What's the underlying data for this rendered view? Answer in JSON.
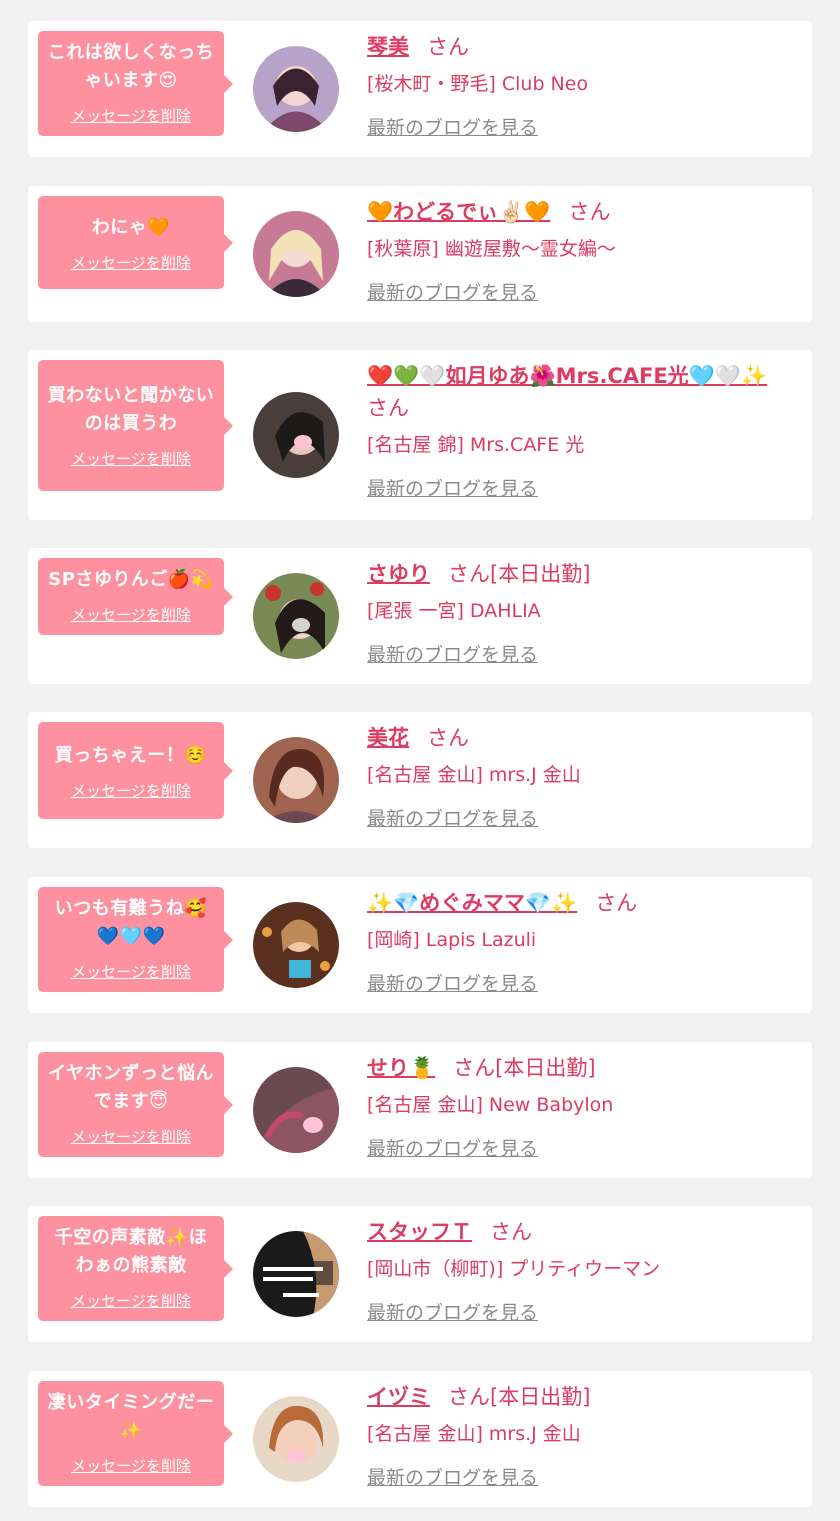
{
  "cards": [
    {
      "message": "これは欲しくなっちゃいます😍",
      "delete_label": "メッセージを削除",
      "name": "琴美",
      "san": "さん",
      "shop": "[桜木町・野毛] Club Neo",
      "blog": "最新のブログを見る",
      "avatar_color": "#7b4a6a"
    },
    {
      "message": "わにゃ🧡",
      "delete_label": "メッセージを削除",
      "name": "🧡わどるでぃ✌🏻🧡",
      "san": "さん",
      "shop": "[秋葉原] 幽遊屋敷～霊女編～",
      "blog": "最新のブログを見る",
      "avatar_color": "#3a2a3c"
    },
    {
      "message": "買わないと聞かないのは買うわ",
      "delete_label": "メッセージを削除",
      "name": "❤️💚🤍如月ゆあ🌺Mrs.CAFE光🩵🤍✨",
      "san": "さん",
      "shop": "[名古屋 錦] Mrs.CAFE 光",
      "blog": "最新のブログを見る",
      "avatar_color": "#2e2a2a"
    },
    {
      "message": "SPさゆりんご🍎💫",
      "delete_label": "メッセージを削除",
      "name": "さゆり",
      "san": "さん[本日出勤]",
      "shop": "[尾張 一宮] DAHLIA",
      "blog": "最新のブログを見る",
      "avatar_color": "#5b4c3a"
    },
    {
      "message": "買っちゃえー！☺️",
      "delete_label": "メッセージを削除",
      "name": "美花",
      "san": "さん",
      "shop": "[名古屋 金山] mrs.J 金山",
      "blog": "最新のブログを見る",
      "avatar_color": "#8a5a4a"
    },
    {
      "message": "いつも有難うね🥰💙🩵💙",
      "delete_label": "メッセージを削除",
      "name": "✨💎めぐみママ💎✨",
      "san": "さん",
      "shop": "[岡崎] Lapis Lazuli",
      "blog": "最新のブログを見る",
      "avatar_color": "#6a3a24"
    },
    {
      "message": "イヤホンずっと悩んでます😇",
      "delete_label": "メッセージを削除",
      "name": "せり🍍",
      "san": "さん[本日出勤]",
      "shop": "[名古屋 金山] New Babylon",
      "blog": "最新のブログを見る",
      "avatar_color": "#5a3a44"
    },
    {
      "message": "千空の声素敵✨ほわぁの熊素敵",
      "delete_label": "メッセージを削除",
      "name": "スタッフＴ",
      "san": "さん",
      "shop": "[岡山市（柳町)] プリティウーマン",
      "blog": "最新のブログを見る",
      "avatar_color": "#2a2a2a"
    },
    {
      "message": "凄いタイミングだー✨",
      "delete_label": "メッセージを削除",
      "name": "イヅミ",
      "san": "さん[本日出勤]",
      "shop": "[名古屋 金山] mrs.J 金山",
      "blog": "最新のブログを見る",
      "avatar_color": "#c89a78"
    }
  ]
}
